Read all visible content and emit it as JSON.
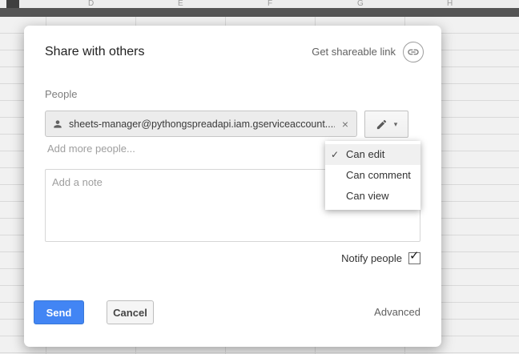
{
  "background": {
    "columns": [
      "D",
      "E",
      "F",
      "G",
      "H"
    ]
  },
  "dialog": {
    "title": "Share with others",
    "get_link_label": "Get shareable link",
    "people_label": "People",
    "chip": {
      "email": "sheets-manager@pythongspreadapi.iam.gserviceaccount....",
      "remove_glyph": "×"
    },
    "add_more_placeholder": "Add more people...",
    "edit_button": {
      "caret_glyph": "▾"
    },
    "permission_menu": {
      "check_glyph": "✓",
      "items": [
        {
          "label": "Can edit",
          "checked": true
        },
        {
          "label": "Can comment",
          "checked": false
        },
        {
          "label": "Can view",
          "checked": false
        }
      ]
    },
    "note_placeholder": "Add a note",
    "notify": {
      "label": "Notify people",
      "checked": true,
      "check_glyph": "✓"
    },
    "buttons": {
      "send": "Send",
      "cancel": "Cancel"
    },
    "advanced_label": "Advanced",
    "colors": {
      "send_button": "#4285f4",
      "dialog_bg": "#ffffff",
      "topbar": "#555555"
    }
  }
}
